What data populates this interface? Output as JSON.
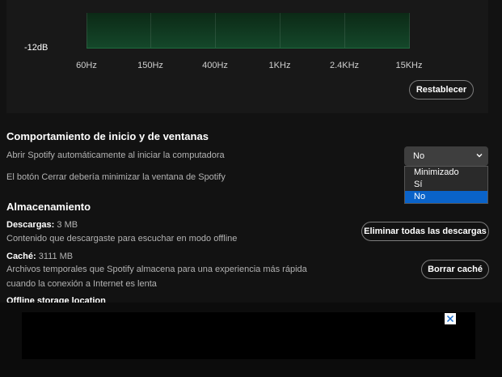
{
  "equalizer": {
    "db_label": "-12dB",
    "frequencies": [
      "60Hz",
      "150Hz",
      "400Hz",
      "1KHz",
      "2.4KHz",
      "15KHz"
    ],
    "reset_label": "Restablecer"
  },
  "startup": {
    "title": "Comportamiento de inicio y de ventanas",
    "open_on_login_label": "Abrir Spotify automáticamente al iniciar la computadora",
    "open_on_login_value": "No",
    "close_button_label": "El botón Cerrar debería minimizar la ventana de Spotify",
    "dropdown_options": [
      "Minimizado",
      "Sí",
      "No"
    ],
    "dropdown_selected": "No"
  },
  "storage": {
    "title": "Almacenamiento",
    "downloads_label": "Descargas:",
    "downloads_size": "3 MB",
    "downloads_desc": "Contenido que descargaste para escuchar en modo offline",
    "delete_downloads_label": "Eliminar todas las descargas",
    "cache_label": "Caché:",
    "cache_size": "3111 MB",
    "cache_desc_line1": "Archivos temporales que Spotify almacena para una experiencia más rápida",
    "cache_desc_line2": "cuando la conexión a Internet es lenta",
    "clear_cache_label": "Borrar caché",
    "offline_location_label": "Offline storage location"
  },
  "ad": {
    "close_icon": "close-icon"
  }
}
